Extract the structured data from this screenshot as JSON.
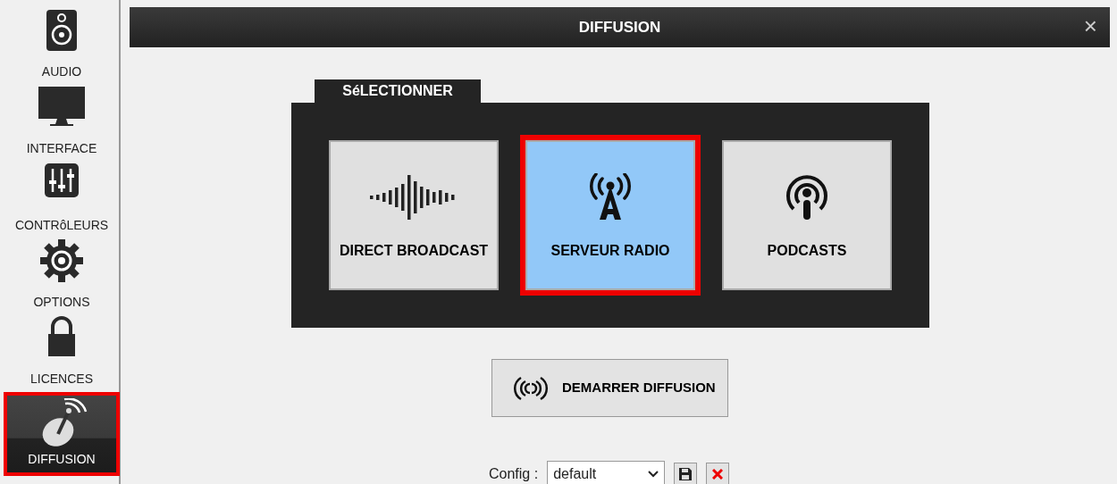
{
  "sidebar": {
    "items": [
      {
        "label": "AUDIO",
        "kind": "speaker",
        "selected": false
      },
      {
        "label": "INTERFACE",
        "kind": "monitor",
        "selected": false
      },
      {
        "label": "CONTRôLEURS",
        "kind": "mixer",
        "selected": false
      },
      {
        "label": "OPTIONS",
        "kind": "gear",
        "selected": false
      },
      {
        "label": "LICENCES",
        "kind": "lock",
        "selected": false
      },
      {
        "label": "DIFFUSION",
        "kind": "dish",
        "selected": true
      }
    ]
  },
  "dialog": {
    "title": "DIFFUSION",
    "close": "×"
  },
  "select_tab": {
    "label": "SéLECTIONNER"
  },
  "options": [
    {
      "label": "DIRECT BROADCAST",
      "kind": "wave",
      "selected": false
    },
    {
      "label": "SERVEUR RADIO",
      "kind": "tower",
      "selected": true
    },
    {
      "label": "PODCASTS",
      "kind": "podcast",
      "selected": false
    }
  ],
  "start_button": {
    "label": "DEMARRER DIFFUSION"
  },
  "config": {
    "label": "Config :",
    "value": "default"
  }
}
